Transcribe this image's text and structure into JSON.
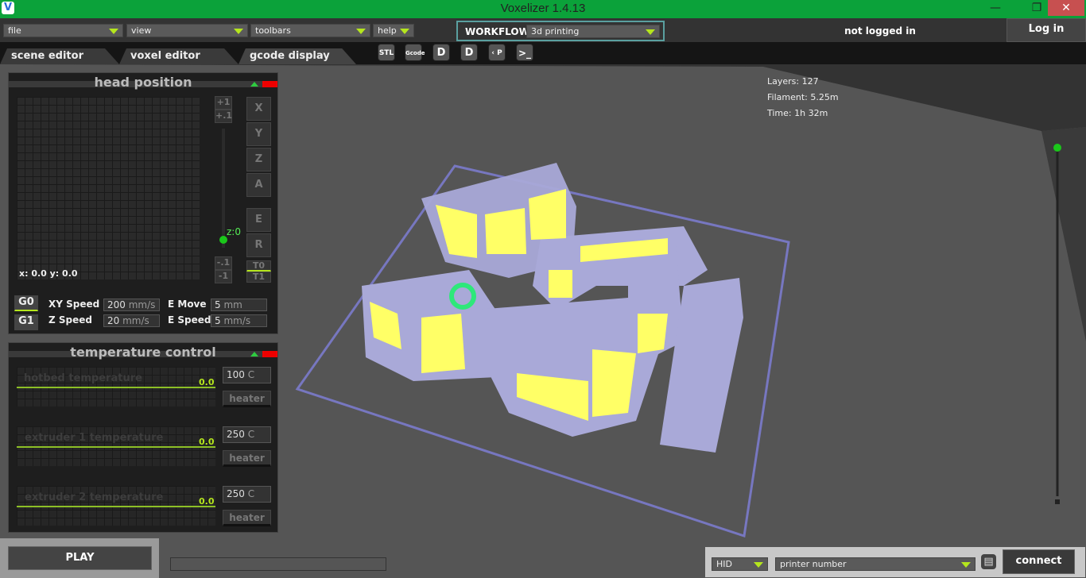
{
  "window": {
    "title": "Voxelizer 1.4.13",
    "logo": "V",
    "controls": [
      "minimize",
      "restore",
      "close"
    ]
  },
  "menu": [
    {
      "label": "file"
    },
    {
      "label": "view"
    },
    {
      "label": "toolbars"
    },
    {
      "label": "help"
    }
  ],
  "workflow": {
    "label": "WORKFLOW:",
    "value": "3d printing"
  },
  "account": {
    "status": "not logged in",
    "login_label": "Log in"
  },
  "tabs": [
    {
      "label": "scene editor"
    },
    {
      "label": "voxel editor"
    },
    {
      "label": "gcode display",
      "active": true
    }
  ],
  "toolbar": [
    {
      "icon": "open-stl-icon",
      "label": "STL"
    },
    {
      "icon": "open-gcode-icon",
      "label": "Gcode"
    },
    {
      "icon": "download-icon",
      "label": "D"
    },
    {
      "icon": "upload-icon",
      "label": "D"
    },
    {
      "icon": "pause-icon",
      "label": "‹ P ›"
    },
    {
      "icon": "terminal-icon",
      "label": ">_"
    }
  ],
  "stats": {
    "layers": "Layers: 127",
    "filament": "Filament: 5.25m",
    "time": "Time: 1h 32m"
  },
  "head_position": {
    "title": "head position",
    "coords": "x: 0.0 y: 0.0",
    "z_label": "z:0",
    "z_buttons": [
      "+1",
      "+.1",
      "-.1",
      "-1"
    ],
    "axis_buttons": [
      "X",
      "Y",
      "Z",
      "A",
      "E",
      "R"
    ],
    "tool_buttons": [
      "T0",
      "T1"
    ],
    "mode_buttons": [
      "G0",
      "G1"
    ],
    "xy_speed": {
      "label": "XY Speed",
      "value": "200",
      "unit": "mm/s"
    },
    "z_speed": {
      "label": "Z Speed",
      "value": "20",
      "unit": "mm/s"
    },
    "e_move": {
      "label": "E Move",
      "value": "5",
      "unit": "mm"
    },
    "e_speed": {
      "label": "E Speed",
      "value": "5",
      "unit": "mm/s"
    }
  },
  "temperature": {
    "title": "temperature control",
    "rows": [
      {
        "name": "hotbed temperature",
        "current": "0.0",
        "target": "100",
        "unit": "C",
        "heater": "heater"
      },
      {
        "name": "extruder 1 temperature",
        "current": "0.0",
        "target": "250",
        "unit": "C",
        "heater": "heater"
      },
      {
        "name": "extruder 2 temperature",
        "current": "0.0",
        "target": "250",
        "unit": "C",
        "heater": "heater"
      }
    ]
  },
  "play_label": "PLAY",
  "connection": {
    "port_type": "HID",
    "printer": "printer number",
    "connect_label": "connect"
  },
  "colors": {
    "titlebar": "#0ba23a",
    "accent": "#b5e61d",
    "part": "#a9a9d8",
    "part_fill": "#ffff66",
    "bed": "#7777c0"
  }
}
